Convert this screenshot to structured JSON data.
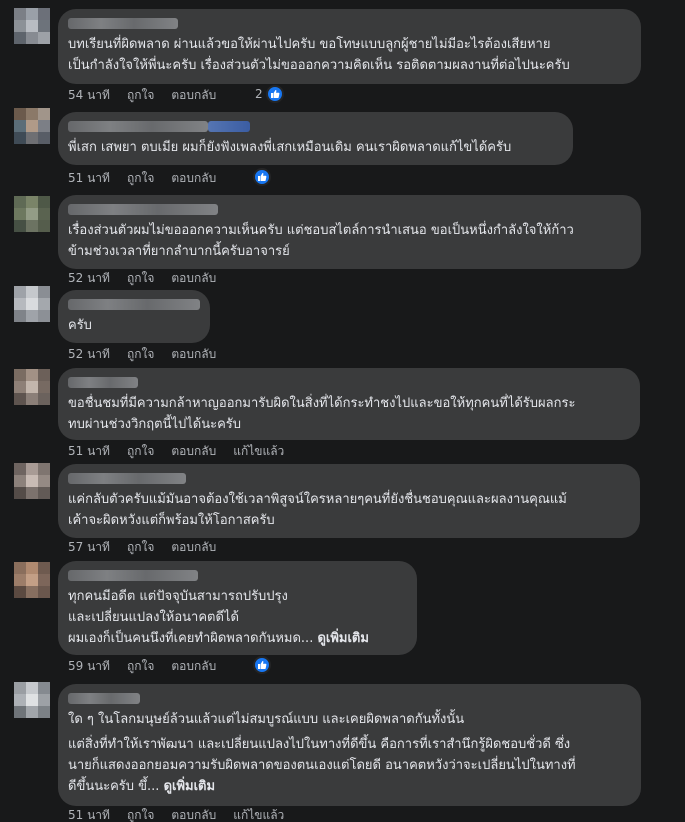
{
  "comments": [
    {
      "lines": [
        "บทเรียนที่ผิดพลาด ผ่านแล้วขอให้ผ่านไปครับ ขอโทษแบบลูกผู้ชายไม่มีอะไรต้องเสียหาย\nเป็นกำลังใจให้พี่นะครับ เรื่องส่วนตัวไม่ขอออกความคิดเห็น รอติดตามผลงานที่ต่อไปนะครับ"
      ],
      "time": "54 นาที",
      "like": "ถูกใจ",
      "reply": "ตอบกลับ",
      "reaction_count": "2"
    },
    {
      "lines": [
        "พี่เสก เสพยา ตบเมีย ผมก็ยังฟังเพลงพี่เสกเหมือนเดิม คนเราผิดพลาดแก้ไขได้ครับ"
      ],
      "time": "51 นาที",
      "like": "ถูกใจ",
      "reply": "ตอบกลับ",
      "reaction_count": ""
    },
    {
      "lines": [
        "เรื่องส่วนตัวผมไม่ขอออกความเห็นครับ แต่ชอบสไตล์การนำเสนอ ขอเป็นหนึ่งกำลังใจให้ก้าว\nข้ามช่วงเวลาที่ยากลำบากนี้ครับอาจารย์"
      ],
      "time": "52 นาที",
      "like": "ถูกใจ",
      "reply": "ตอบกลับ"
    },
    {
      "lines": [
        "ครับ"
      ],
      "time": "52 นาที",
      "like": "ถูกใจ",
      "reply": "ตอบกลับ"
    },
    {
      "lines": [
        "ขอชื่นชมที่มีความกล้าหาญออกมารับผิดในสิ่งที่ได้กระทำชงไปและขอให้ทุกคนที่ได้รับผลกระ\nทบผ่านช่วงวิกฤตนี้ไปได้นะครับ"
      ],
      "time": "51 นาที",
      "like": "ถูกใจ",
      "reply": "ตอบกลับ",
      "edited": "แก้ไขแล้ว"
    },
    {
      "lines": [
        "แค่กลับตัวครับแม้มันอาจต้องใช้เวลาพิสูจน์ใครหลายๆคนที่ยังชื่นชอบคุณและผลงานคุณแม้\nเค้าจะผิดหวังแต่ก็พร้อมให้โอกาสครับ"
      ],
      "time": "57 นาที",
      "like": "ถูกใจ",
      "reply": "ตอบกลับ"
    },
    {
      "lines": [
        "ทุกคนมีอดีต แต่ปัจจุบันสามารถปรับปรุง\nและเปลี่ยนแปลงให้อนาคตดีได้\nผมเองก็เป็นคนนึงที่เคยทำผิดพลาดกันหมด..."
      ],
      "see_more": "ดูเพิ่มเติม",
      "time": "59 นาที",
      "like": "ถูกใจ",
      "reply": "ตอบกลับ"
    },
    {
      "lines": [
        "ใด ๆ ในโลกมนุษย์ล้วนแล้วแต่ไม่สมบูรณ์แบบ และเคยผิดพลาดกันทั้งนั้น",
        "แต่สิ่งที่ทำให้เราพัฒนา และเปลี่ยนแปลงไปในทางที่ดีขึ้น คือการที่เราสำนึกรู้ผิดชอบชั่วดี ซึ่ง\nนายก็แสดงออกยอมความรับผิดพลาดของตนเองแต่โดยดี อนาคตหวังว่าจะเปลี่ยนไปในทางที่\nดีขึ้นนะครับ ขึ้..."
      ],
      "see_more": "ดูเพิ่มเติม",
      "time": "51 นาที",
      "like": "ถูกใจ",
      "reply": "ตอบกลับ",
      "edited": "แก้ไขแล้ว"
    }
  ],
  "colors": {
    "background": "#18191a",
    "bubble": "#3a3b3c",
    "text": "#e4e6eb",
    "meta": "#b0b3b8",
    "like_blue": "#1877f2"
  },
  "icons": {
    "reaction": "like-thumb-icon"
  }
}
